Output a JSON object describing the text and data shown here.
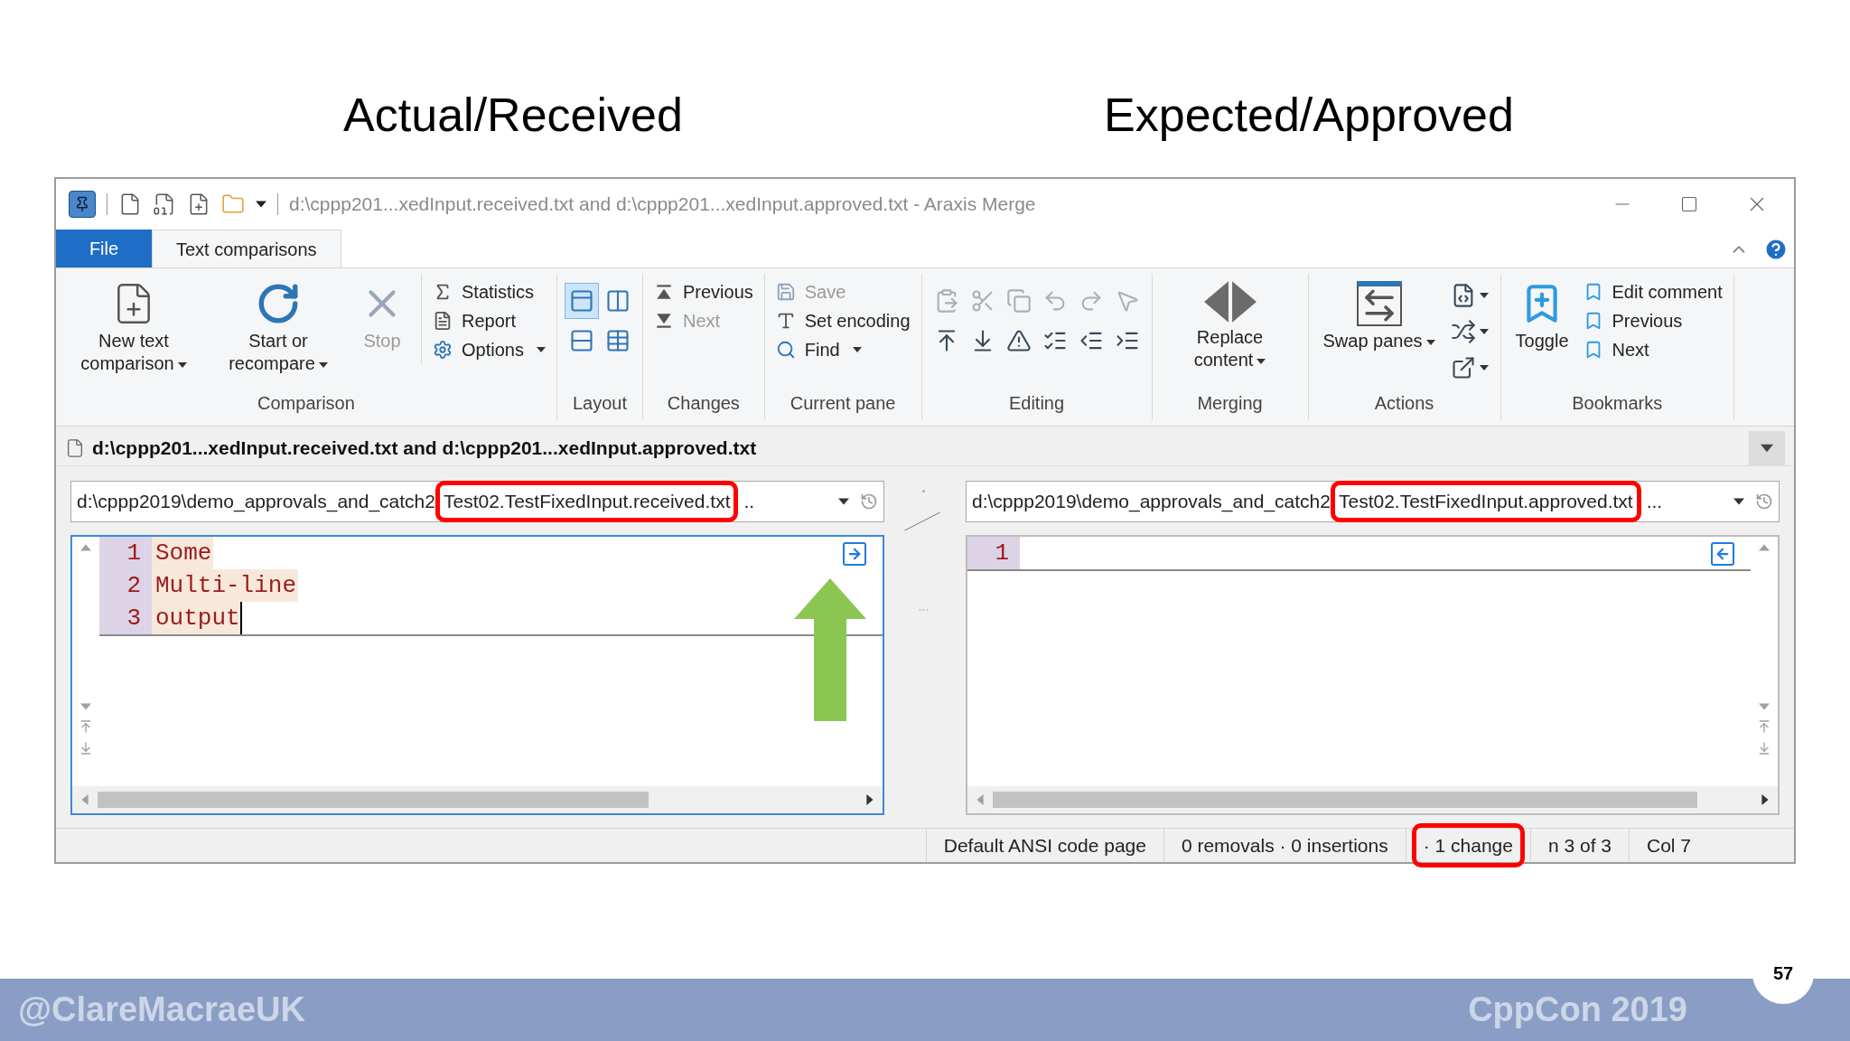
{
  "slide_headings": [
    "Actual/Received",
    "Expected/Approved"
  ],
  "window": {
    "title": "d:\\cppp201...xedInput.received.txt and d:\\cppp201...xedInput.approved.txt - Araxis Merge"
  },
  "ribbon_tabs": [
    {
      "label": "File",
      "kind": "file",
      "selected": false
    },
    {
      "label": "Text comparisons",
      "kind": "tab",
      "selected": true
    }
  ],
  "ribbon_groups": [
    {
      "label": "Comparison",
      "items": [
        {
          "kind": "large",
          "label": "New text comparison",
          "dropdown": true,
          "disabled": false
        },
        {
          "kind": "large",
          "label": "Start or recompare",
          "dropdown": true,
          "disabled": false
        },
        {
          "kind": "large",
          "label": "Stop",
          "dropdown": false,
          "disabled": true
        },
        {
          "kind": "small",
          "label": "Statistics",
          "dropdown": false,
          "disabled": false
        },
        {
          "kind": "small",
          "label": "Report",
          "dropdown": false,
          "disabled": false
        },
        {
          "kind": "small",
          "label": "Options",
          "dropdown": true,
          "disabled": false
        }
      ]
    },
    {
      "label": "Layout",
      "items": [
        {
          "kind": "icon",
          "selected": true
        },
        {
          "kind": "icon",
          "selected": false
        },
        {
          "kind": "icon",
          "selected": false
        },
        {
          "kind": "icon",
          "selected": false
        }
      ]
    },
    {
      "label": "Changes",
      "items": [
        {
          "kind": "small",
          "label": "Previous",
          "dropdown": false,
          "disabled": false
        },
        {
          "kind": "small",
          "label": "Next",
          "dropdown": false,
          "disabled": true
        }
      ]
    },
    {
      "label": "Current pane",
      "items": [
        {
          "kind": "small",
          "label": "Save",
          "dropdown": false,
          "disabled": true
        },
        {
          "kind": "small",
          "label": "Set encoding",
          "dropdown": false,
          "disabled": false
        },
        {
          "kind": "small",
          "label": "Find",
          "dropdown": true,
          "disabled": false
        }
      ]
    },
    {
      "label": "Editing",
      "items": [
        {
          "kind": "icon",
          "disabled": true
        },
        {
          "kind": "icon",
          "disabled": true
        },
        {
          "kind": "icon",
          "disabled": true
        },
        {
          "kind": "icon",
          "disabled": true
        },
        {
          "kind": "icon",
          "disabled": true
        },
        {
          "kind": "icon",
          "disabled": true
        },
        {
          "kind": "icon",
          "disabled": false
        },
        {
          "kind": "icon",
          "disabled": false
        },
        {
          "kind": "icon",
          "disabled": false
        },
        {
          "kind": "icon",
          "disabled": false
        },
        {
          "kind": "icon",
          "disabled": false
        },
        {
          "kind": "icon",
          "disabled": false
        }
      ]
    },
    {
      "label": "Merging",
      "items": [
        {
          "kind": "large",
          "label": "Replace content",
          "dropdown": true,
          "disabled": false
        }
      ]
    },
    {
      "label": "Actions",
      "items": [
        {
          "kind": "large",
          "label": "Swap panes",
          "dropdown": true,
          "disabled": false
        },
        {
          "kind": "icon",
          "dropdown": true
        },
        {
          "kind": "icon",
          "dropdown": true
        },
        {
          "kind": "icon",
          "dropdown": true
        }
      ]
    },
    {
      "label": "Bookmarks",
      "items": [
        {
          "kind": "large",
          "label": "Toggle",
          "dropdown": false,
          "disabled": false
        },
        {
          "kind": "small",
          "label": "Edit comment",
          "dropdown": false,
          "disabled": false
        },
        {
          "kind": "small",
          "label": "Previous",
          "dropdown": false,
          "disabled": false
        },
        {
          "kind": "small",
          "label": "Next",
          "dropdown": false,
          "disabled": false
        }
      ]
    }
  ],
  "document_tab": {
    "title": "d:\\cppp201...xedInput.received.txt and d:\\cppp201...xedInput.approved.txt"
  },
  "panes": [
    {
      "path": "d:\\cppp2019\\demo_approvals_and_catch2",
      "file": "Test02.TestFixedInput.received.txt",
      "marked": true,
      "overflow": "..",
      "focused": true,
      "kind": "received",
      "lines": [
        {
          "number": "1",
          "text": "Some",
          "cursor": false
        },
        {
          "number": "2",
          "text": "Multi-line",
          "cursor": false
        },
        {
          "number": "3",
          "text": "output",
          "cursor": true
        }
      ]
    },
    {
      "path": "d:\\cppp2019\\demo_approvals_and_catch2",
      "file": "Test02.TestFixedInput.approved.txt",
      "marked": true,
      "overflow": "...",
      "focused": false,
      "kind": "approved",
      "lines": [
        {
          "number": "1",
          "cursor": false
        }
      ]
    }
  ],
  "status_bar": [
    {
      "text": "Default ANSI code page",
      "marked": false
    },
    {
      "text": "0 removals · 0 insertions",
      "marked": false
    },
    {
      "text": "· 1 change",
      "marked": true
    },
    {
      "text": "n 3 of 3",
      "marked": false
    },
    {
      "text": "Col 7",
      "marked": false
    }
  ],
  "footer": {
    "author": "@ClareMacraeUK",
    "event": "CppCon 2019",
    "page": "57"
  }
}
